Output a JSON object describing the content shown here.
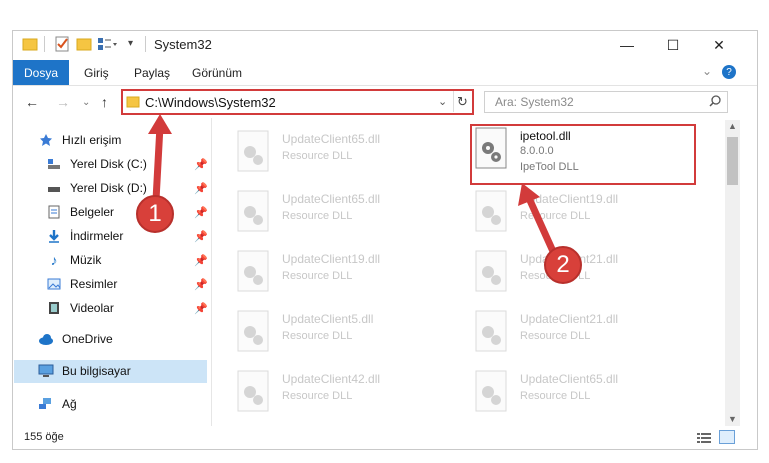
{
  "window": {
    "title": "System32",
    "controls": {
      "minimize": "—",
      "maximize": "☐",
      "close": "✕"
    }
  },
  "ribbon": {
    "tabs": [
      "Dosya",
      "Giriş",
      "Paylaş",
      "Görünüm"
    ],
    "help": "?"
  },
  "nav": {
    "address": "C:\\Windows\\System32",
    "search_placeholder": "Ara: System32"
  },
  "sidebar": {
    "items": [
      {
        "label": "Hızlı erişim",
        "icon": "star-icon"
      },
      {
        "label": "Yerel Disk (C:)",
        "icon": "drive-icon"
      },
      {
        "label": "Yerel Disk (D:)",
        "icon": "drive-icon"
      },
      {
        "label": "Belgeler",
        "icon": "documents-icon"
      },
      {
        "label": "İndirmeler",
        "icon": "download-icon"
      },
      {
        "label": "Müzik",
        "icon": "music-icon"
      },
      {
        "label": "Resimler",
        "icon": "pictures-icon"
      },
      {
        "label": "Videolar",
        "icon": "videos-icon"
      },
      {
        "label": "OneDrive",
        "icon": "cloud-icon"
      },
      {
        "label": "Bu bilgisayar",
        "icon": "computer-icon"
      },
      {
        "label": "Ağ",
        "icon": "network-icon"
      }
    ]
  },
  "files": {
    "left": [
      {
        "name": "UpdateClient65.dll",
        "type": "Resource DLL"
      },
      {
        "name": "UpdateClient65.dll",
        "type": "Resource DLL"
      },
      {
        "name": "UpdateClient19.dll",
        "type": "Resource DLL"
      },
      {
        "name": "UpdateClient5.dll",
        "type": "Resource DLL"
      },
      {
        "name": "UpdateClient42.dll",
        "type": "Resource DLL"
      }
    ],
    "highlighted": {
      "name": "ipetool.dll",
      "version": "8.0.0.0",
      "type": "IpeTool DLL"
    },
    "right": [
      {
        "name": "UpdateClient19.dll",
        "type": "Resource DLL"
      },
      {
        "name": "UpdateClient21.dll",
        "type": "Resource DLL"
      },
      {
        "name": "UpdateClient21.dll",
        "type": "Resource DLL"
      },
      {
        "name": "UpdateClient65.dll",
        "type": "Resource DLL"
      }
    ]
  },
  "status": {
    "count": "155 öğe"
  },
  "callouts": {
    "one": "1",
    "two": "2"
  },
  "colors": {
    "accent": "#1e74c8",
    "highlight": "#d23b3b",
    "selected": "#cce4f7"
  }
}
